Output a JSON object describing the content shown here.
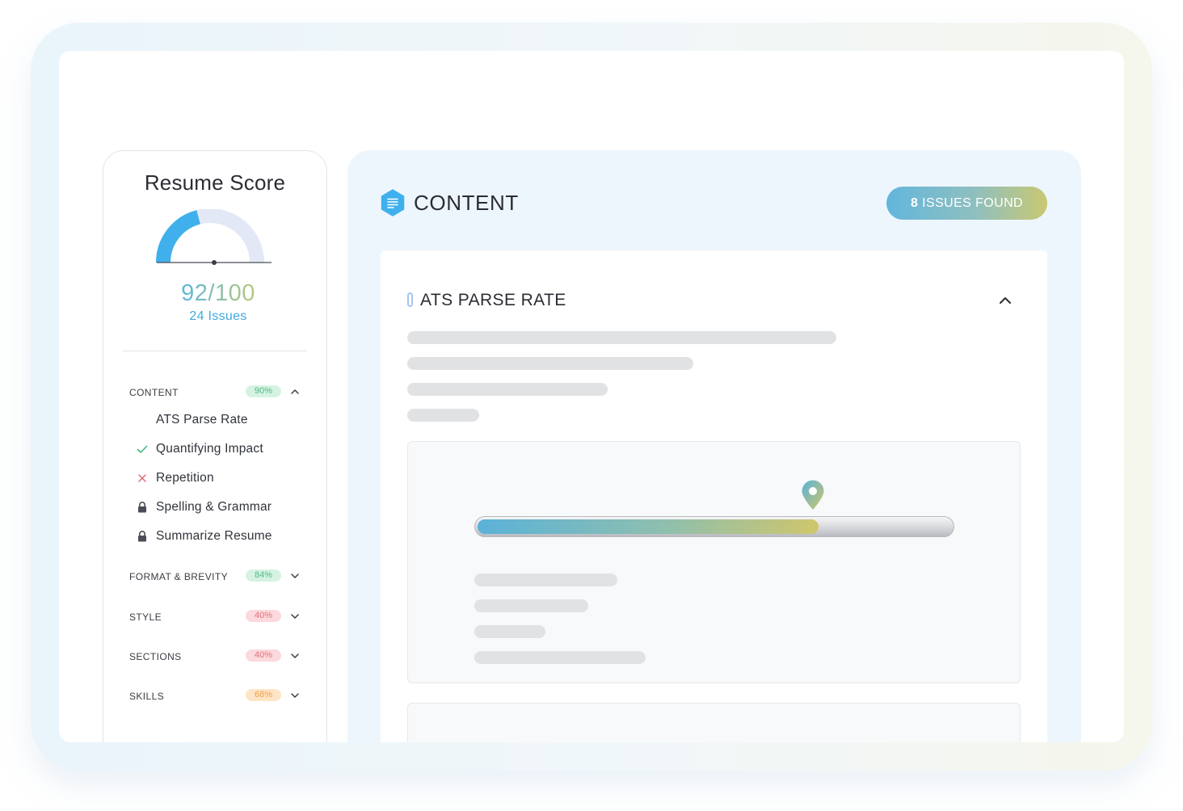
{
  "sidebar": {
    "title": "Resume Score",
    "score": "92/100",
    "score_fraction": 0.92,
    "issues": "24 Issues",
    "categories": [
      {
        "label": "CONTENT",
        "badge": "90%",
        "badge_color": "green",
        "expanded": true,
        "items": [
          {
            "label": "ATS Parse Rate",
            "icon": "none"
          },
          {
            "label": "Quantifying Impact",
            "icon": "check-icon"
          },
          {
            "label": "Repetition",
            "icon": "x-icon"
          },
          {
            "label": "Spelling & Grammar",
            "icon": "lock-icon"
          },
          {
            "label": "Summarize Resume",
            "icon": "lock-icon"
          }
        ]
      },
      {
        "label": "FORMAT & BREVITY",
        "badge": "84%",
        "badge_color": "green",
        "expanded": false
      },
      {
        "label": "STYLE",
        "badge": "40%",
        "badge_color": "red",
        "expanded": false
      },
      {
        "label": "SECTIONS",
        "badge": "40%",
        "badge_color": "red",
        "expanded": false
      },
      {
        "label": "SKILLS",
        "badge": "68%",
        "badge_color": "orange",
        "expanded": false
      }
    ]
  },
  "panel": {
    "title": "CONTENT",
    "icon": "document-icon",
    "issues_button": {
      "count": "8",
      "label": "ISSUES FOUND"
    },
    "section": {
      "title": "ATS PARSE RATE",
      "expanded": true,
      "parse_rate_fraction": 0.72
    }
  },
  "colors": {
    "accent_blue": "#3fa9df",
    "gradient_start": "#5ab2d8",
    "gradient_end": "#cfc66b",
    "badge_green": "#4fb884",
    "badge_red": "#e2717f",
    "badge_orange": "#f0a047"
  }
}
